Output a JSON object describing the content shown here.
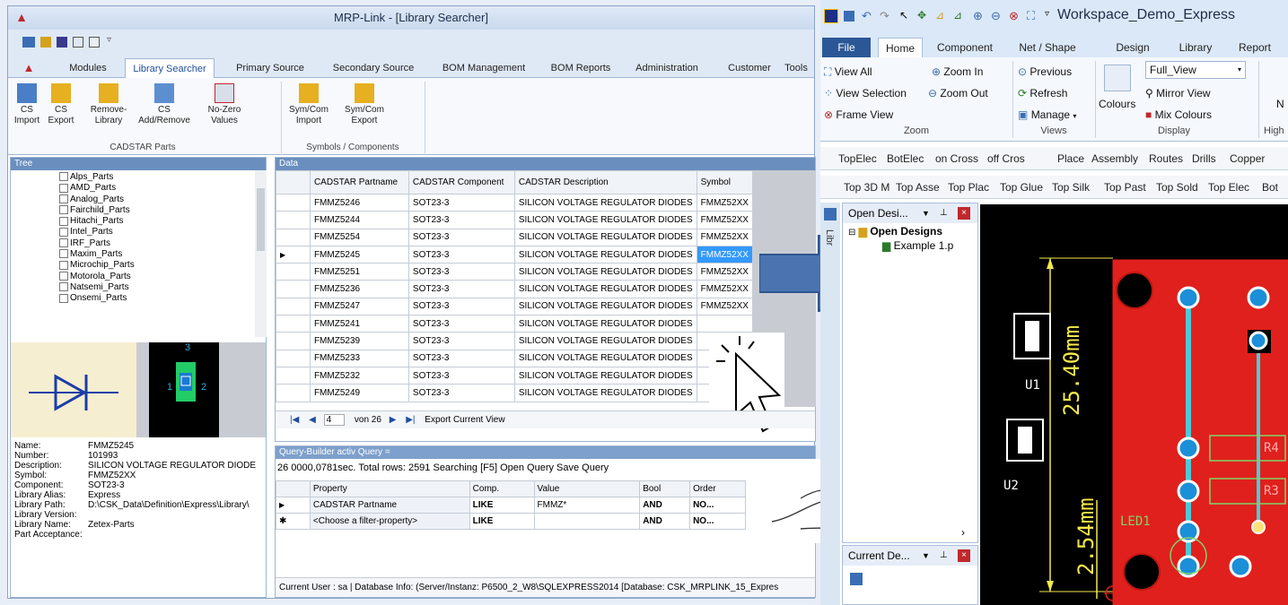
{
  "left_window": {
    "title": "MRP-Link - [Library Searcher]",
    "tabs": [
      "Modules",
      "Library Searcher",
      "Primary Source",
      "Secondary Source",
      "BOM Management",
      "BOM Reports",
      "Administration",
      "Customer",
      "Tools"
    ],
    "ribbon": {
      "buttons": [
        {
          "l1": "CS",
          "l2": "Import"
        },
        {
          "l1": "CS",
          "l2": "Export"
        },
        {
          "l1": "Remove-",
          "l2": "Library"
        },
        {
          "l1": "CS",
          "l2": "Add/Remove"
        },
        {
          "l1": "No-Zero",
          "l2": "Values"
        },
        {
          "l1": "Sym/Com",
          "l2": "Import"
        },
        {
          "l1": "Sym/Com",
          "l2": "Export"
        }
      ],
      "group1": "CADSTAR Parts",
      "group2": "Symbols / Components"
    },
    "tree": {
      "header": "Tree",
      "items": [
        "Alps_Parts",
        "AMD_Parts",
        "Analog_Parts",
        "Fairchild_Parts",
        "Hitachi_Parts",
        "Intel_Parts",
        "IRF_Parts",
        "Maxim_Parts",
        "Microchip_Parts",
        "Motorola_Parts",
        "Natsemi_Parts",
        "Onsemi_Parts"
      ]
    },
    "pin_labels": {
      "p1": "1",
      "p2": "2",
      "p3": "3"
    },
    "props": [
      {
        "k": "Name:",
        "v": "FMMZ5245"
      },
      {
        "k": "Number:",
        "v": "101993"
      },
      {
        "k": "Description:",
        "v": "SILICON VOLTAGE REGULATOR DIODE"
      },
      {
        "k": "Symbol:",
        "v": "FMMZ52XX"
      },
      {
        "k": "Component:",
        "v": "SOT23-3"
      },
      {
        "k": "Library Alias:",
        "v": "Express"
      },
      {
        "k": "Library Path:",
        "v": "D:\\CSK_Data\\Definition\\Express\\Library\\"
      },
      {
        "k": "Library Version:",
        "v": ""
      },
      {
        "k": "Library Name:",
        "v": "Zetex-Parts"
      },
      {
        "k": "Part Acceptance:",
        "v": ""
      }
    ],
    "data_grid": {
      "header": "Data",
      "columns": [
        "CADSTAR Partname",
        "CADSTAR Component",
        "CADSTAR Description",
        "Symbol"
      ],
      "rows": [
        [
          "FMMZ5246",
          "SOT23-3",
          "SILICON VOLTAGE REGULATOR DIODES",
          "FMMZ52XX"
        ],
        [
          "FMMZ5244",
          "SOT23-3",
          "SILICON VOLTAGE REGULATOR DIODES",
          "FMMZ52XX"
        ],
        [
          "FMMZ5254",
          "SOT23-3",
          "SILICON VOLTAGE REGULATOR DIODES",
          "FMMZ52XX"
        ],
        [
          "FMMZ5245",
          "SOT23-3",
          "SILICON VOLTAGE REGULATOR DIODES",
          "FMMZ52XX"
        ],
        [
          "FMMZ5251",
          "SOT23-3",
          "SILICON VOLTAGE REGULATOR DIODES",
          "FMMZ52XX"
        ],
        [
          "FMMZ5236",
          "SOT23-3",
          "SILICON VOLTAGE REGULATOR DIODES",
          "FMMZ52XX"
        ],
        [
          "FMMZ5247",
          "SOT23-3",
          "SILICON VOLTAGE REGULATOR DIODES",
          "FMMZ52XX"
        ],
        [
          "FMMZ5241",
          "SOT23-3",
          "SILICON VOLTAGE REGULATOR DIODES",
          ""
        ],
        [
          "FMMZ5239",
          "SOT23-3",
          "SILICON VOLTAGE REGULATOR DIODES",
          ""
        ],
        [
          "FMMZ5233",
          "SOT23-3",
          "SILICON VOLTAGE REGULATOR DIODES",
          ""
        ],
        [
          "FMMZ5232",
          "SOT23-3",
          "SILICON VOLTAGE REGULATOR DIODES",
          ""
        ],
        [
          "FMMZ5249",
          "SOT23-3",
          "SILICON VOLTAGE REGULATOR DIODES",
          ""
        ]
      ],
      "selected_row": 3,
      "nav": {
        "page": "4",
        "of": "von 26",
        "export": "Export Current View"
      }
    },
    "query": {
      "header": "Query-Builder activ Query =",
      "status": "26 0000,0781sec.  Total rows: 2591  Searching [F5]  Open Query  Save Query",
      "columns": [
        "Property",
        "Comp.",
        "Value",
        "Bool",
        "Order"
      ],
      "rows": [
        [
          "CADSTAR Partname",
          "LIKE",
          "FMMZ*",
          "AND",
          "NO..."
        ],
        [
          "<Choose a filter-property>",
          "LIKE",
          "",
          "AND",
          "NO..."
        ]
      ]
    },
    "status": "Current User :   sa  | Database Info:     (Server/Instanz:  P6500_2_W8\\SQLEXPRESS2014  [Database: CSK_MRPLINK_15_Expres"
  },
  "right_window": {
    "title": "Workspace_Demo_Express",
    "tabs": [
      "File",
      "Home",
      "Component",
      "Net / Shape",
      "Design",
      "Library",
      "Report"
    ],
    "zoom": {
      "view_all": "View All",
      "zoom_in": "Zoom In",
      "view_selection": "View Selection",
      "zoom_out": "Zoom Out",
      "frame_view": "Frame View",
      "group": "Zoom"
    },
    "views": {
      "previous": "Previous",
      "refresh": "Refresh",
      "manage": "Manage",
      "group": "Views"
    },
    "display": {
      "full_view": "Full_View",
      "colours": "Colours",
      "mirror_view": "Mirror View",
      "mix_colours": "Mix Colours",
      "group": "Display"
    },
    "n_label": "N",
    "high": "High",
    "layer_bar1": [
      "TopElec",
      "BotElec",
      "on Cross",
      "off Cros",
      "Place",
      "Assembly",
      "Routes",
      "Drills",
      "Copper"
    ],
    "layer_bar2": [
      "Top 3D M",
      "Top Asse",
      "Top Plac",
      "Top Glue",
      "Top Silk",
      "Top Past",
      "Top Sold",
      "Top Elec",
      "Bot"
    ],
    "open_designs": {
      "title": "Open Desi...",
      "root": "Open Designs",
      "child": "Example 1.p"
    },
    "side_tab": "Libr",
    "current_designs": "Current De...",
    "pcb": {
      "dim1": "25.40mm",
      "dim2": "2.54mm",
      "u1": "U1",
      "u2": "U2",
      "led": "LED1",
      "r4": "R4",
      "r3": "R3"
    }
  }
}
